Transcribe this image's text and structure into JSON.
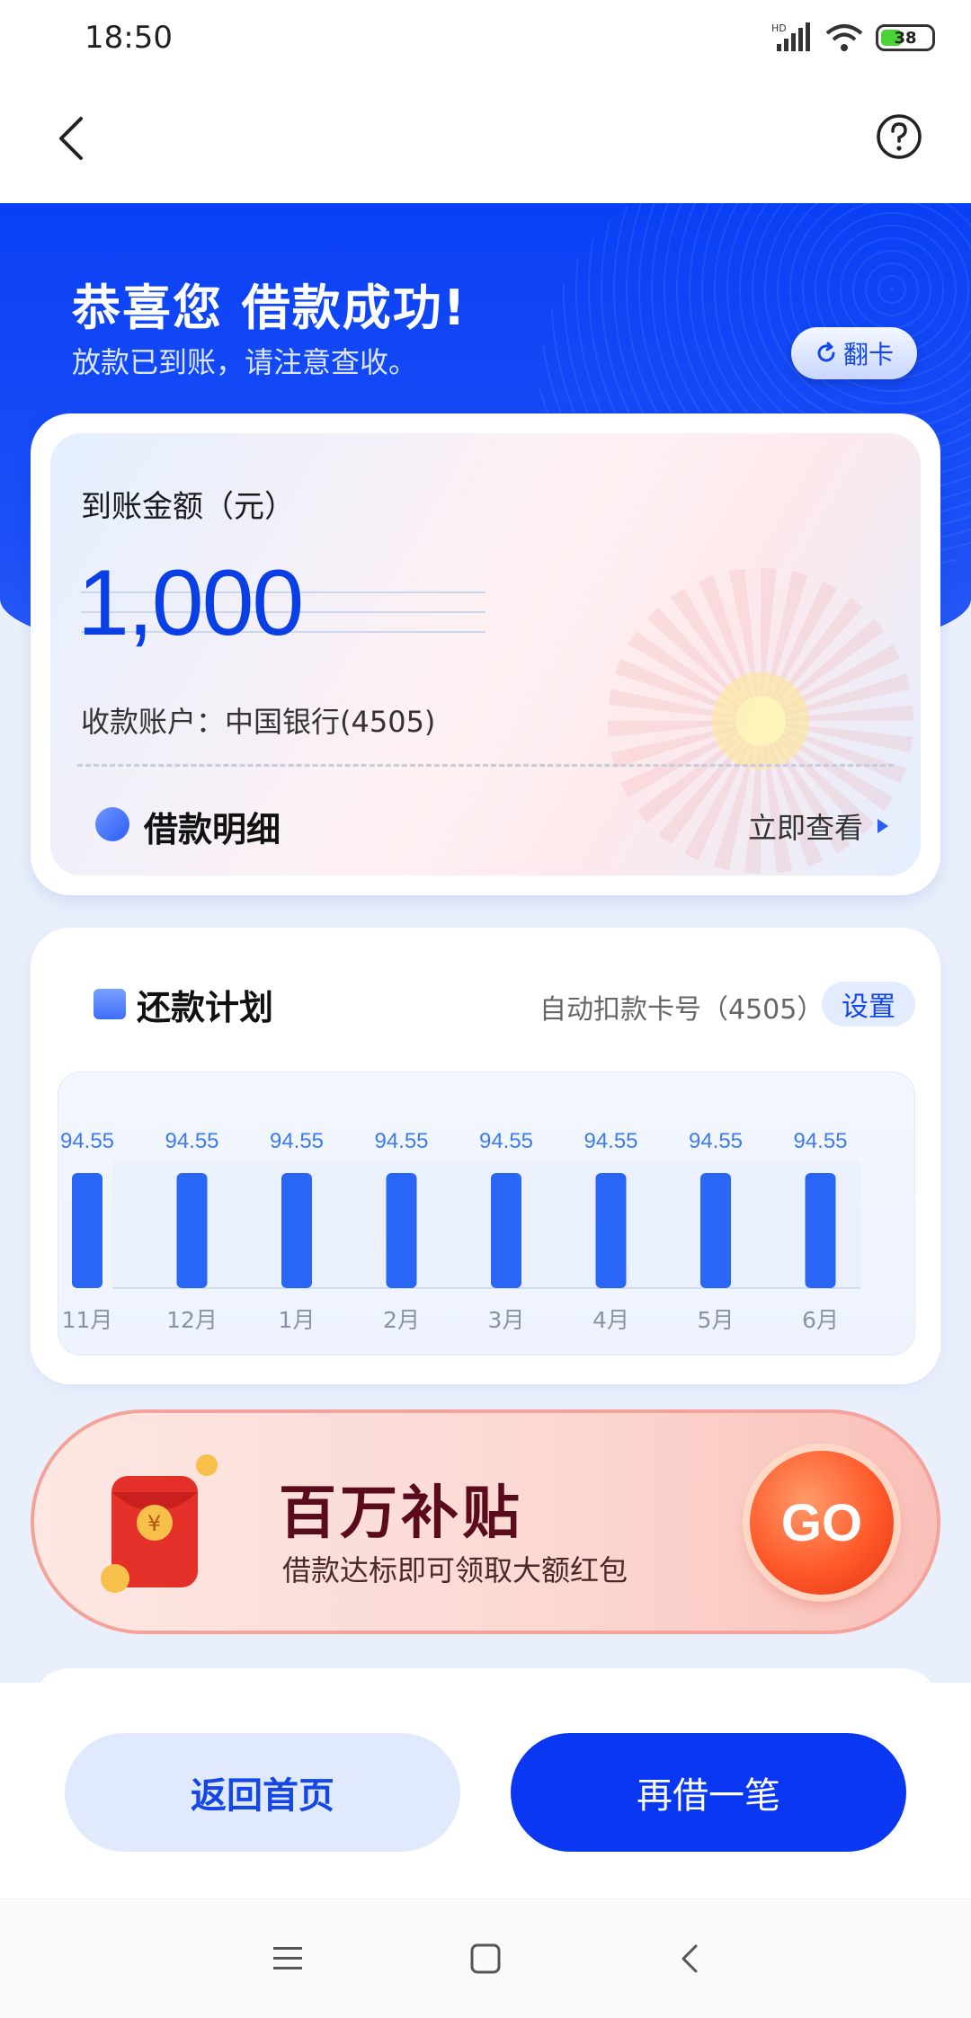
{
  "status_bar": {
    "time": "18:50",
    "network": "HD",
    "battery": "38"
  },
  "header": {
    "back_icon": "back-arrow-icon",
    "help_icon": "question-icon"
  },
  "hero": {
    "title": "恭喜您 借款成功!",
    "subtitle": "放款已到账，请注意查收。",
    "flip_label": "翻卡"
  },
  "arrival": {
    "label": "到账金额（元）",
    "amount": "1,000",
    "account": "收款账户：中国银行(4505)",
    "detail_title": "借款明细",
    "detail_link": "立即查看"
  },
  "plan": {
    "title": "还款计划",
    "card_number": "自动扣款卡号（4505）",
    "settings_label": "设置"
  },
  "chart_data": {
    "type": "bar",
    "categories": [
      "11月",
      "12月",
      "1月",
      "2月",
      "3月",
      "4月",
      "5月",
      "6月"
    ],
    "values": [
      94.55,
      94.55,
      94.55,
      94.55,
      94.55,
      94.55,
      94.55,
      94.55
    ],
    "value_labels": [
      "94.55",
      "94.55",
      "94.55",
      "94.55",
      "94.55",
      "94.55",
      "94.55",
      "94.55"
    ],
    "color": "#2a66f6"
  },
  "subsidy": {
    "title": "百万补贴",
    "desc": "借款达标即可领取大额红包",
    "go_label": "GO"
  },
  "actions": {
    "home": "返回首页",
    "borrow_again": "再借一笔"
  },
  "colors": {
    "primary": "#0a40f5",
    "accent": "#1447e6",
    "subsidy_title": "#5a0c1c"
  }
}
